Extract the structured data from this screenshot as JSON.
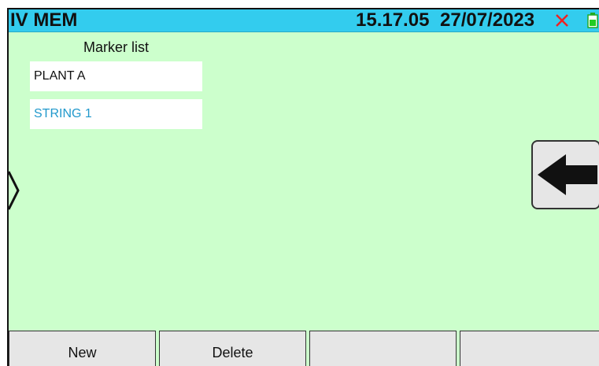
{
  "header": {
    "title": "IV MEM",
    "time": "15.17.05",
    "date": "27/07/2023",
    "status_icon": "close-x-icon",
    "battery_icon": "battery-icon",
    "bar_color": "#33ccee",
    "x_color": "#ee2222"
  },
  "marker_list": {
    "title": "Marker list",
    "items": [
      {
        "label": "PLANT A",
        "selected": false
      },
      {
        "label": "STRING 1",
        "selected": true
      }
    ],
    "selected_color": "#2299cc"
  },
  "controls": {
    "expand_icon": "chevron-right-icon",
    "back_icon": "arrow-left-icon"
  },
  "softkeys": [
    {
      "label": "New"
    },
    {
      "label": "Delete"
    },
    {
      "label": ""
    },
    {
      "label": ""
    }
  ],
  "screen_background": "#ccffcc"
}
